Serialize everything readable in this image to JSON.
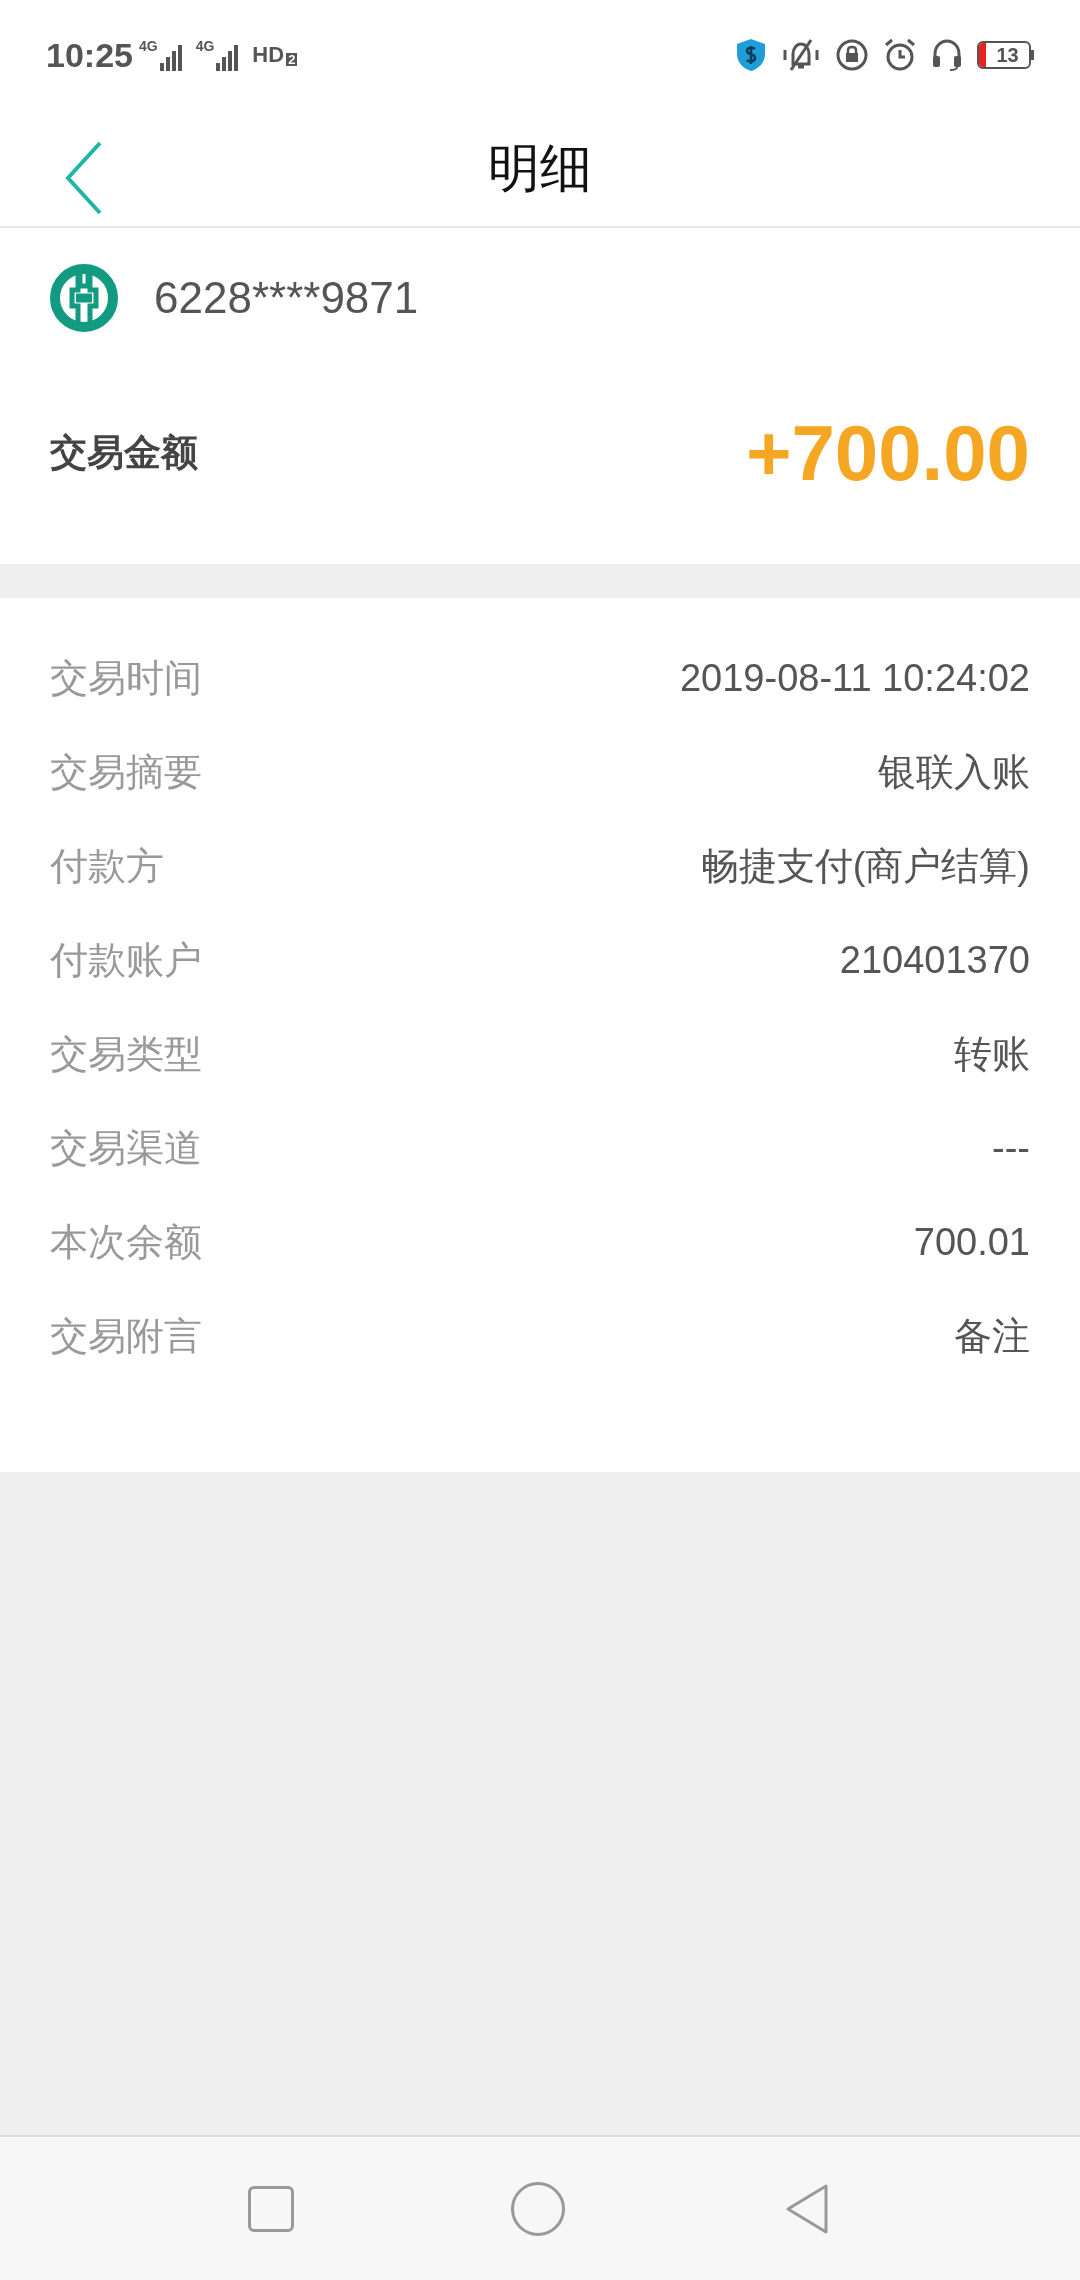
{
  "status_bar": {
    "time": "10:25",
    "sim_1": "4G",
    "sim_2": "4G",
    "hd_label": "HD",
    "hd_index": "2",
    "battery": "13"
  },
  "header": {
    "title": "明细"
  },
  "card": {
    "number": "6228****9871"
  },
  "amount": {
    "label": "交易金额",
    "value": "+700.00"
  },
  "details": [
    {
      "label": "交易时间",
      "value": "2019-08-11 10:24:02"
    },
    {
      "label": "交易摘要",
      "value": "银联入账"
    },
    {
      "label": "付款方",
      "value": "畅捷支付(商户结算)"
    },
    {
      "label": "付款账户",
      "value": "210401370"
    },
    {
      "label": "交易类型",
      "value": "转账"
    },
    {
      "label": "交易渠道",
      "value": "---"
    },
    {
      "label": "本次余额",
      "value": "700.01"
    },
    {
      "label": "交易附言",
      "value": "备注"
    }
  ]
}
